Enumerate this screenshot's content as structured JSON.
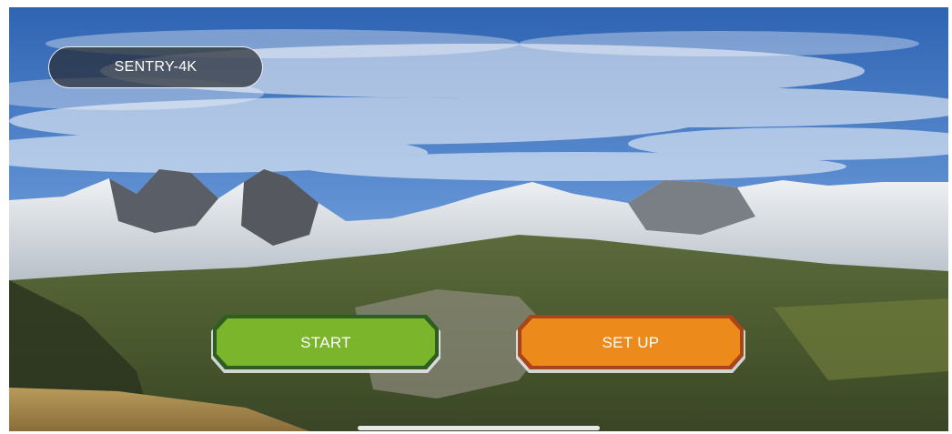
{
  "device": {
    "name": "SENTRY-4K"
  },
  "buttons": {
    "start_label": "START",
    "setup_label": "SET UP"
  },
  "colors": {
    "start_fill": "#7bb52c",
    "start_border": "#2f5e23",
    "setup_fill": "#ec8a1c",
    "setup_border": "#a8451a",
    "sky": "#3f78c4"
  },
  "icons": [
    "home-indicator"
  ]
}
